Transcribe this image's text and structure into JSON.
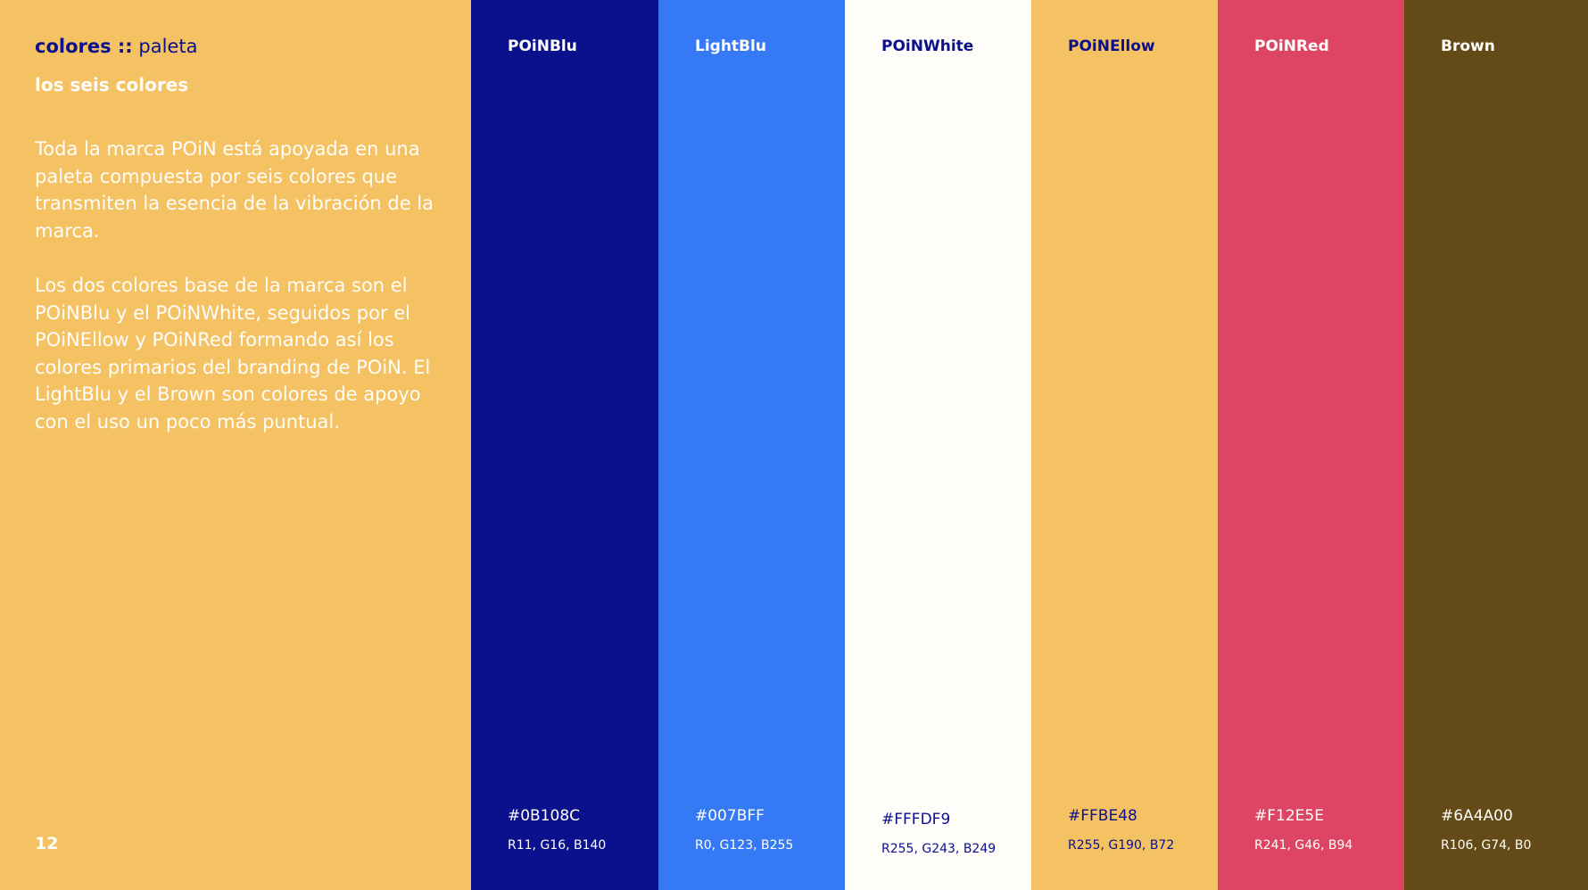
{
  "header": {
    "bold": "colores ::",
    "light": "paleta"
  },
  "subtitle": "los seis colores",
  "paragraphs": [
    "Toda la marca POiN está apoyada en una paleta compuesta por seis colores que transmiten la esencia de la vibración de la marca.",
    "Los dos colores base de la marca son el POiNBlu y el POiNWhite, seguidos por el POiNEllow y POiNRed formando así los colores primarios del branding de POiN. El LightBlu y el Brown son colores de apoyo con el uso un poco más puntual."
  ],
  "page_number": "12",
  "background_color": "#F4C262",
  "swatches": [
    {
      "name": "POiNBlu",
      "hex": "#0B108C",
      "rgb": "R11, G16, B140",
      "color": "#0B108C",
      "text_color": "#FFFDF9"
    },
    {
      "name": "LightBlu",
      "hex": "#007BFF",
      "rgb": "R0, G123, B255",
      "color": "#3679F5",
      "text_color": "#FFFDF9"
    },
    {
      "name": "POiNWhite",
      "hex": "#FFFDF9",
      "rgb": "R255, G243, B249",
      "color": "#FFFDF9",
      "text_color": "#0B108C"
    },
    {
      "name": "POiNEllow",
      "hex": "#FFBE48",
      "rgb": "R255, G190, B72",
      "color": "#F4C262",
      "text_color": "#0B108C"
    },
    {
      "name": "POiNRed",
      "hex": "#F12E5E",
      "rgb": "R241, G46, B94",
      "color": "#DE4565",
      "text_color": "#FFFDF9"
    },
    {
      "name": "Brown",
      "hex": "#6A4A00",
      "rgb": "R106, G74, B0",
      "color": "#634A17",
      "text_color": "#FFFDF9"
    }
  ]
}
